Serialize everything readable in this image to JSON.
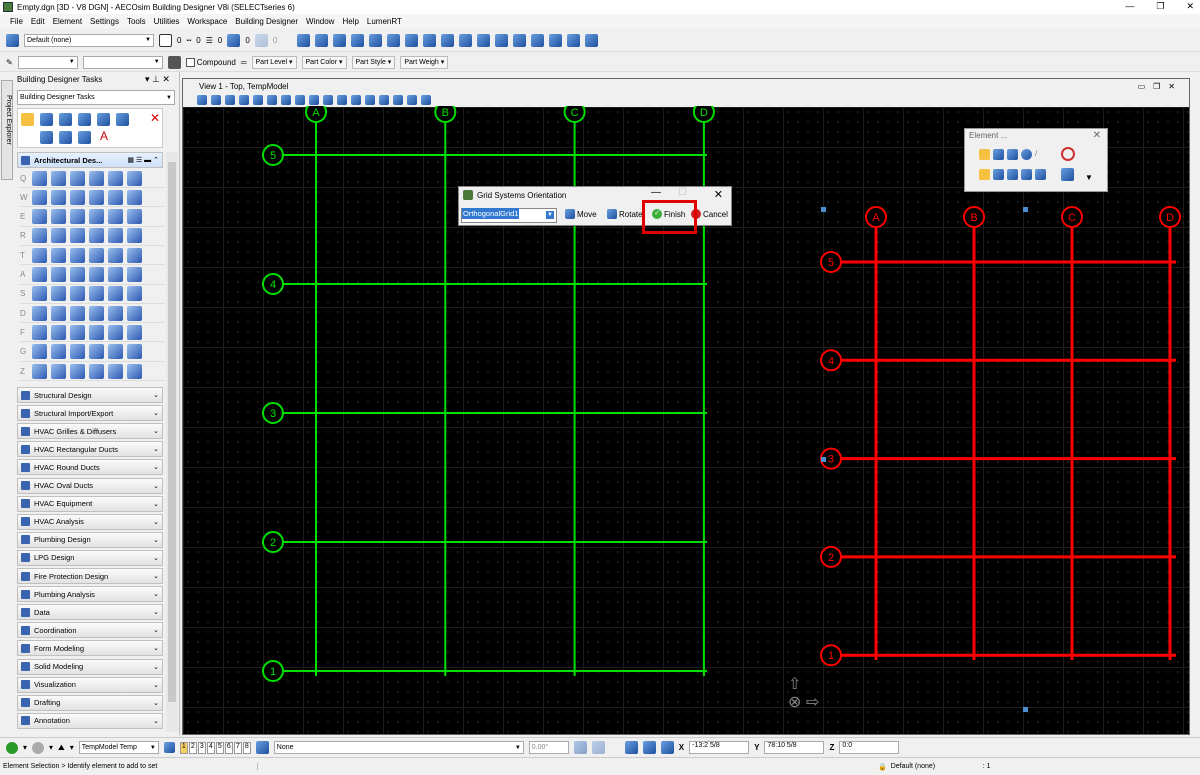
{
  "window": {
    "title": "Empty.dgn [3D - V8 DGN] - AECOsim Building Designer V8i (SELECTseries 6)",
    "min": "—",
    "max": "❐",
    "close": "✕"
  },
  "menu": [
    "File",
    "Edit",
    "Element",
    "Settings",
    "Tools",
    "Utilities",
    "Workspace",
    "Building Designer",
    "Window",
    "Help",
    "LumenRT"
  ],
  "toolbar1": {
    "level": "Default (none)",
    "color": "0",
    "style": "0",
    "weight": "0",
    "transparency": "0",
    "priority": "0"
  },
  "toolbar2": {
    "compound": "Compound",
    "part_level": "Part Level",
    "part_color": "Part Color",
    "part_style": "Part Style",
    "part_weight": "Part Weigh"
  },
  "tasks": {
    "header": "Building Designer Tasks",
    "combo": "Building Designer Tasks",
    "project_explorer": "Project Explorer",
    "section": "Architectural Des...",
    "icon_rows": [
      "Q",
      "W",
      "E",
      "R",
      "T",
      "A",
      "S",
      "D",
      "F",
      "G",
      "Z"
    ],
    "groups": [
      "Structural Design",
      "Structural Import/Export",
      "HVAC Grilles & Diffusers",
      "HVAC Rectangular Ducts",
      "HVAC Round Ducts",
      "HVAC Oval Ducts",
      "HVAC Equipment",
      "HVAC Analysis",
      "Plumbing Design",
      "LPG Design",
      "Fire Protection Design",
      "Plumbing Analysis",
      "Data",
      "Coordination",
      "Form Modeling",
      "Solid Modeling",
      "Visualization",
      "Drafting",
      "Annotation"
    ]
  },
  "view": {
    "title": "View 1 - Top, TempModel"
  },
  "green_grid": {
    "color": "#00e000",
    "columns": [
      "A",
      "B",
      "C",
      "D"
    ],
    "rows": [
      "5",
      "4",
      "3",
      "2",
      "1"
    ]
  },
  "red_grid": {
    "color": "#ff0000",
    "columns": [
      "A",
      "B",
      "C",
      "D"
    ],
    "rows": [
      "5",
      "4",
      "3",
      "2",
      "1"
    ]
  },
  "dialog": {
    "title": "Grid Systems Orientation",
    "grid": "OrthogonalGrid1",
    "move": "Move",
    "rotate": "Rotate",
    "finish": "Finish",
    "cancel": "Cancel"
  },
  "element_dialog": {
    "title": "Element ..."
  },
  "bottom": {
    "model": "TempModel Temp",
    "views": [
      "1",
      "2",
      "3",
      "4",
      "5",
      "6",
      "7",
      "8"
    ],
    "none": "None",
    "angle": "0.00°",
    "x_label": "X",
    "x": "-13:2 5/8",
    "y_label": "Y",
    "y": "78:10 5/8",
    "z_label": "Z",
    "z": "0:0"
  },
  "status": {
    "prompt": "Element Selection > Identify element to add to set",
    "level": "Default (none)",
    "count": ": 1"
  }
}
